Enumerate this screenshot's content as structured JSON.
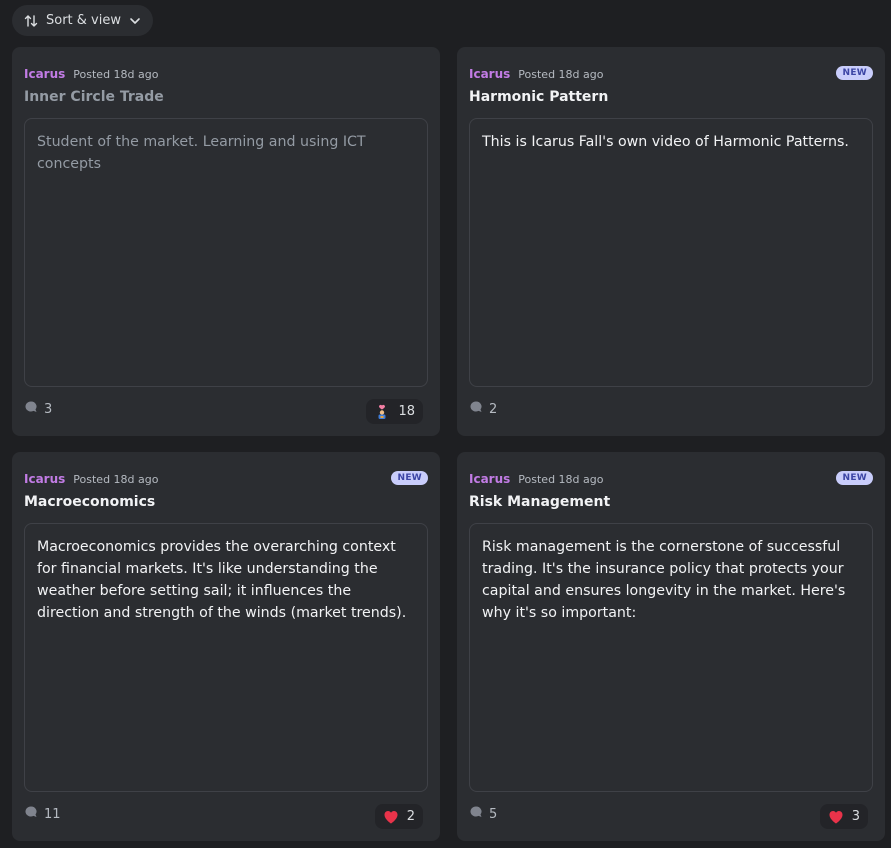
{
  "toolbar": {
    "sort_label": "Sort & view",
    "sort_icon": "sort-arrows-icon",
    "chevron_icon": "chevron-down-icon"
  },
  "posts": [
    {
      "author": "Icarus",
      "posted": "Posted 18d ago",
      "title": "Inner Circle Trade",
      "new": false,
      "body": "Student of the market. Learning and using ICT concepts",
      "comments": "3",
      "reaction": {
        "emoji": "person-with-heart-icon",
        "count": "18"
      }
    },
    {
      "author": "Icarus",
      "posted": "Posted 18d ago",
      "title": "Harmonic Pattern",
      "new": true,
      "badge": "NEW",
      "body": "This is Icarus Fall's own video of Harmonic Patterns.",
      "comments": "2"
    },
    {
      "author": "Icarus",
      "posted": "Posted 18d ago",
      "title": "Macroeconomics",
      "new": true,
      "badge": "NEW",
      "body": "Macroeconomics provides the overarching context for financial markets. It's like understanding the weather before setting sail; it influences the direction and strength of the winds (market trends).",
      "comments": "11",
      "reaction": {
        "emoji": "heart-icon",
        "count": "2"
      }
    },
    {
      "author": "Icarus",
      "posted": "Posted 18d ago",
      "title": "Risk Management",
      "new": true,
      "badge": "NEW",
      "body": "Risk management is the cornerstone of successful trading. It's the insurance policy that protects your capital and ensures longevity in the market. Here's why it's so important:",
      "comments": "5",
      "reaction": {
        "emoji": "heart-icon",
        "count": "3"
      }
    }
  ],
  "colors": {
    "author": "#c27ce5",
    "badge_bg": "#c9cdfb",
    "heart": "#e8334a"
  }
}
